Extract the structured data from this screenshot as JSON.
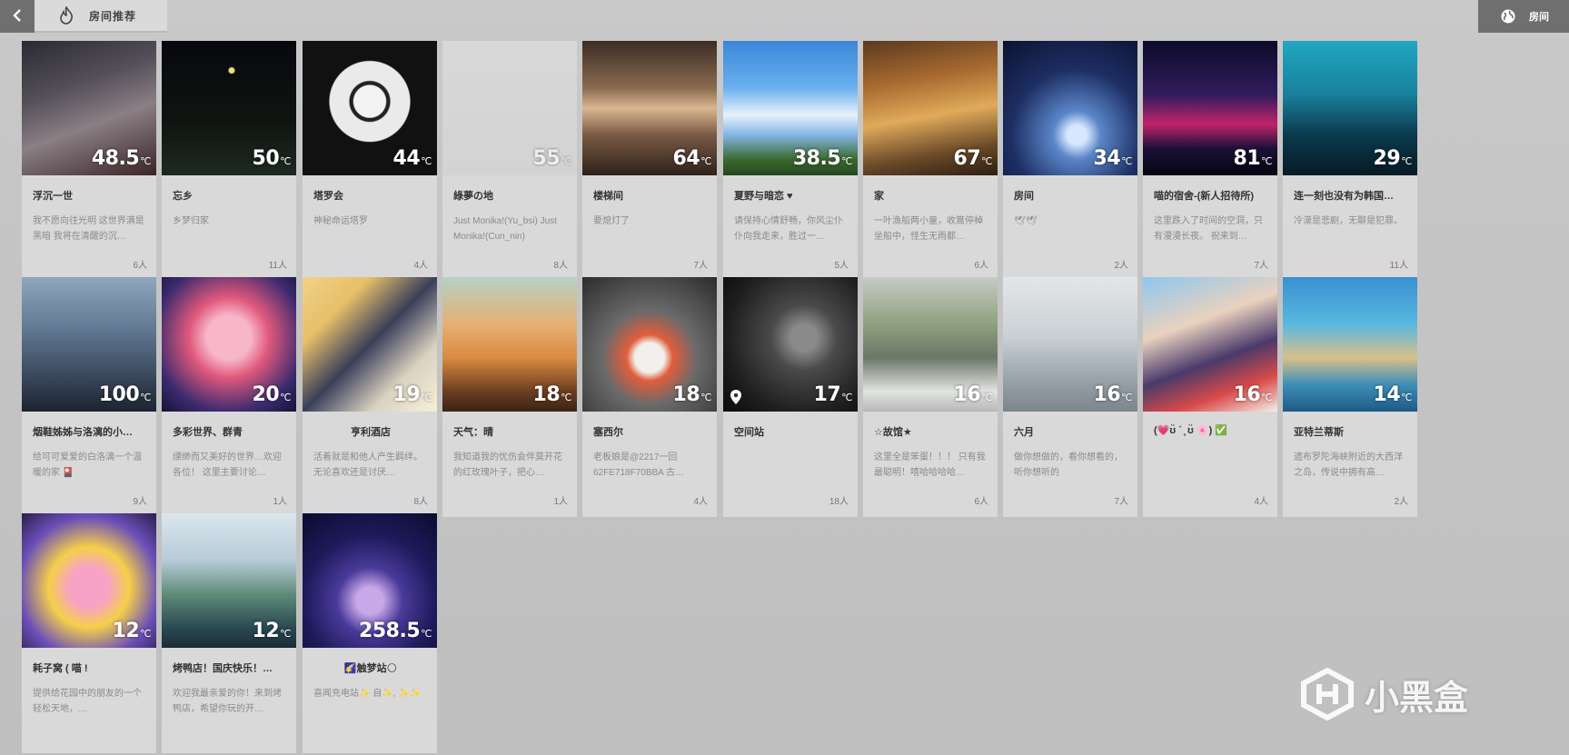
{
  "header": {
    "back_label": "<",
    "tab_label": "房间推荐",
    "room_label": "房间"
  },
  "rooms": [
    {
      "title": "浮沉一世",
      "temp": "48.5",
      "desc": "我不愿向往光明 这世界满是黑暗 我将在清醒的沉…",
      "count": "6人"
    },
    {
      "title": "忘乡",
      "temp": "50",
      "desc": "乡梦归家",
      "count": "11人"
    },
    {
      "title": "塔罗会",
      "temp": "44",
      "desc": "神秘命运塔罗",
      "count": "4人"
    },
    {
      "title": "綠夢の地",
      "temp": "55",
      "desc": "Just Monika!(Yu_bsi) Just Monika!(Cun_nin)",
      "count": "8人"
    },
    {
      "title": "楼梯间",
      "temp": "64",
      "desc": "要熄灯了",
      "count": "7人"
    },
    {
      "title": "夏野与暗恋 ♥",
      "temp": "38.5",
      "desc": "请保持心情舒畅，你风尘仆仆向我走来，胜过一…",
      "count": "5人"
    },
    {
      "title": "家",
      "temp": "67",
      "desc": "一叶渔船两小童，收篙停棹坐船中，怪生无雨都…",
      "count": "6人"
    },
    {
      "title": "房间",
      "temp": "34",
      "desc": "🕊🕊",
      "count": "2人"
    },
    {
      "title": "喵的宿舍-(新人招待所)",
      "temp": "81",
      "desc": "这里跌入了时间的空洞，只有漫漫长夜。 祝来到…",
      "count": "7人"
    },
    {
      "title": "连一刻也没有为韩国…",
      "temp": "29",
      "desc": "冷漠是悲剧，无聊是犯罪。",
      "count": "11人"
    },
    {
      "title": "烟鞋姊姊与洛漓的小…",
      "temp": "100",
      "desc": "给可可爱爱的白洛漓一个温暖的家 🎴",
      "count": "9人"
    },
    {
      "title": "多彩世界、群青",
      "temp": "20",
      "desc": "缥缈而又美好的世界…欢迎各位！ 这里主要讨论…",
      "count": "1人"
    },
    {
      "title": "亨利酒店",
      "temp": "19",
      "desc": "活着就是和他人产生羁绊。无论喜欢还是讨厌…",
      "count": "8人"
    },
    {
      "title": "天气：晴",
      "temp": "18",
      "desc": "我知道我的忧伤会伴莫开花的红玫瑰叶子，把心…",
      "count": "1人"
    },
    {
      "title": "塞西尔",
      "temp": "18",
      "desc": "老板娘是@2217一回62FE718F70BBA 古…",
      "count": "4人"
    },
    {
      "title": "空间站",
      "temp": "17",
      "desc": "",
      "count": "18人"
    },
    {
      "title": "☆故馆★",
      "temp": "16",
      "desc": "这里全是笨蛋！！！ 只有我最聪明！嘻哈哈哈哈…",
      "count": "6人"
    },
    {
      "title": "六月",
      "temp": "16",
      "desc": "做你想做的，看你想看的，听你想听的",
      "count": "7人"
    },
    {
      "title": "(💗ʊ̈ ´ ͈ ʊ̈ 🌸) ✅",
      "temp": "16",
      "desc": "",
      "count": "4人"
    },
    {
      "title": "亚特兰蒂斯",
      "temp": "14",
      "desc": "遗布罗陀海峡附近的大西洋之岛，传说中拥有高…",
      "count": "2人"
    },
    {
      "title": "耗子窝 ( 喵 !",
      "temp": "12",
      "desc": "提供给花园中的朋友的一个轻松天地，…",
      "count": ""
    },
    {
      "title": "烤鸭店！国庆快乐！…",
      "temp": "12",
      "desc": "欢迎我最亲爱的你！来到烤鸭店，希望你玩的开…",
      "count": ""
    },
    {
      "title": "🌠触梦站🌕",
      "temp": "258.5",
      "desc": "喜闻充电站✨ 自✨, ✨✨",
      "count": ""
    }
  ],
  "temp_unit": "℃",
  "watermark": "小黑盒"
}
